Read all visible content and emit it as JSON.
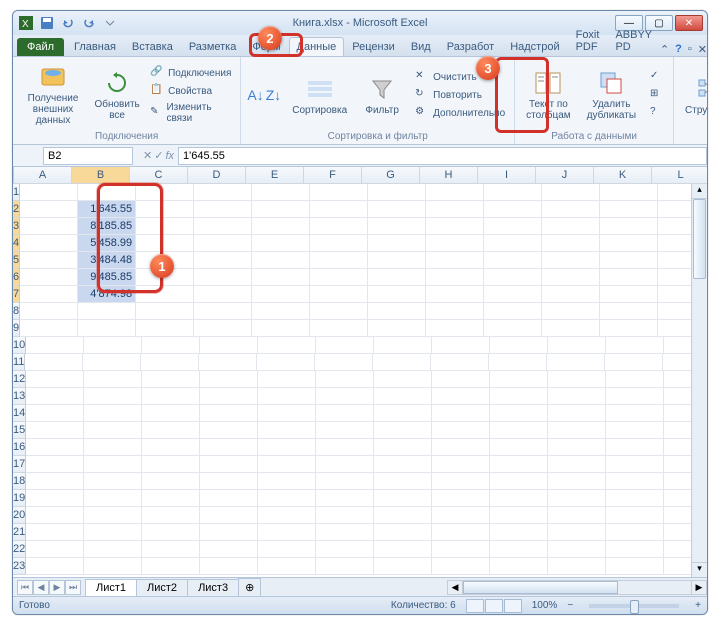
{
  "titlebar": {
    "doc_title": "Книга.xlsx - Microsoft Excel"
  },
  "tabs": {
    "file": "Файл",
    "items": [
      "Главная",
      "Вставка",
      "Разметка",
      "Форм",
      "Данные",
      "Рецензи",
      "Вид",
      "Разработ",
      "Надстрой",
      "Foxit PDF",
      "ABBYY PD"
    ],
    "active_index": 4
  },
  "ribbon": {
    "group_conn": {
      "external_data": "Получение\nвнешних данных",
      "refresh": "Обновить\nвсе",
      "connections": "Подключения",
      "properties": "Свойства",
      "edit_links": "Изменить связи",
      "label": "Подключения"
    },
    "group_sort": {
      "sort": "Сортировка",
      "filter": "Фильтр",
      "clear": "Очистить",
      "reapply": "Повторить",
      "advanced": "Дополнительно",
      "label": "Сортировка и фильтр"
    },
    "group_tools": {
      "text_to_cols": "Текст по\nстолбцам",
      "remove_dup": "Удалить\nдубликаты",
      "structure": "Структура",
      "label": "Работа с данными"
    }
  },
  "formula_bar": {
    "namebox": "B2",
    "formula": "1'645.55"
  },
  "grid": {
    "columns": [
      "A",
      "B",
      "C",
      "D",
      "E",
      "F",
      "G",
      "H",
      "I",
      "J",
      "K",
      "L"
    ],
    "rows": 23,
    "selected_col_index": 1,
    "selected_rows": [
      2,
      3,
      4,
      5,
      6,
      7
    ],
    "data": {
      "B2": "1'645.55",
      "B3": "8'185.85",
      "B4": "5'458.99",
      "B5": "3'484.48",
      "B6": "9'485.85",
      "B7": "4'874.98"
    }
  },
  "sheets": {
    "tabs": [
      "Лист1",
      "Лист2",
      "Лист3"
    ],
    "active": 0
  },
  "statusbar": {
    "ready": "Готово",
    "count_label": "Количество:",
    "count_value": "6",
    "zoom": "100%"
  },
  "markers": {
    "m1": "1",
    "m2": "2",
    "m3": "3"
  }
}
